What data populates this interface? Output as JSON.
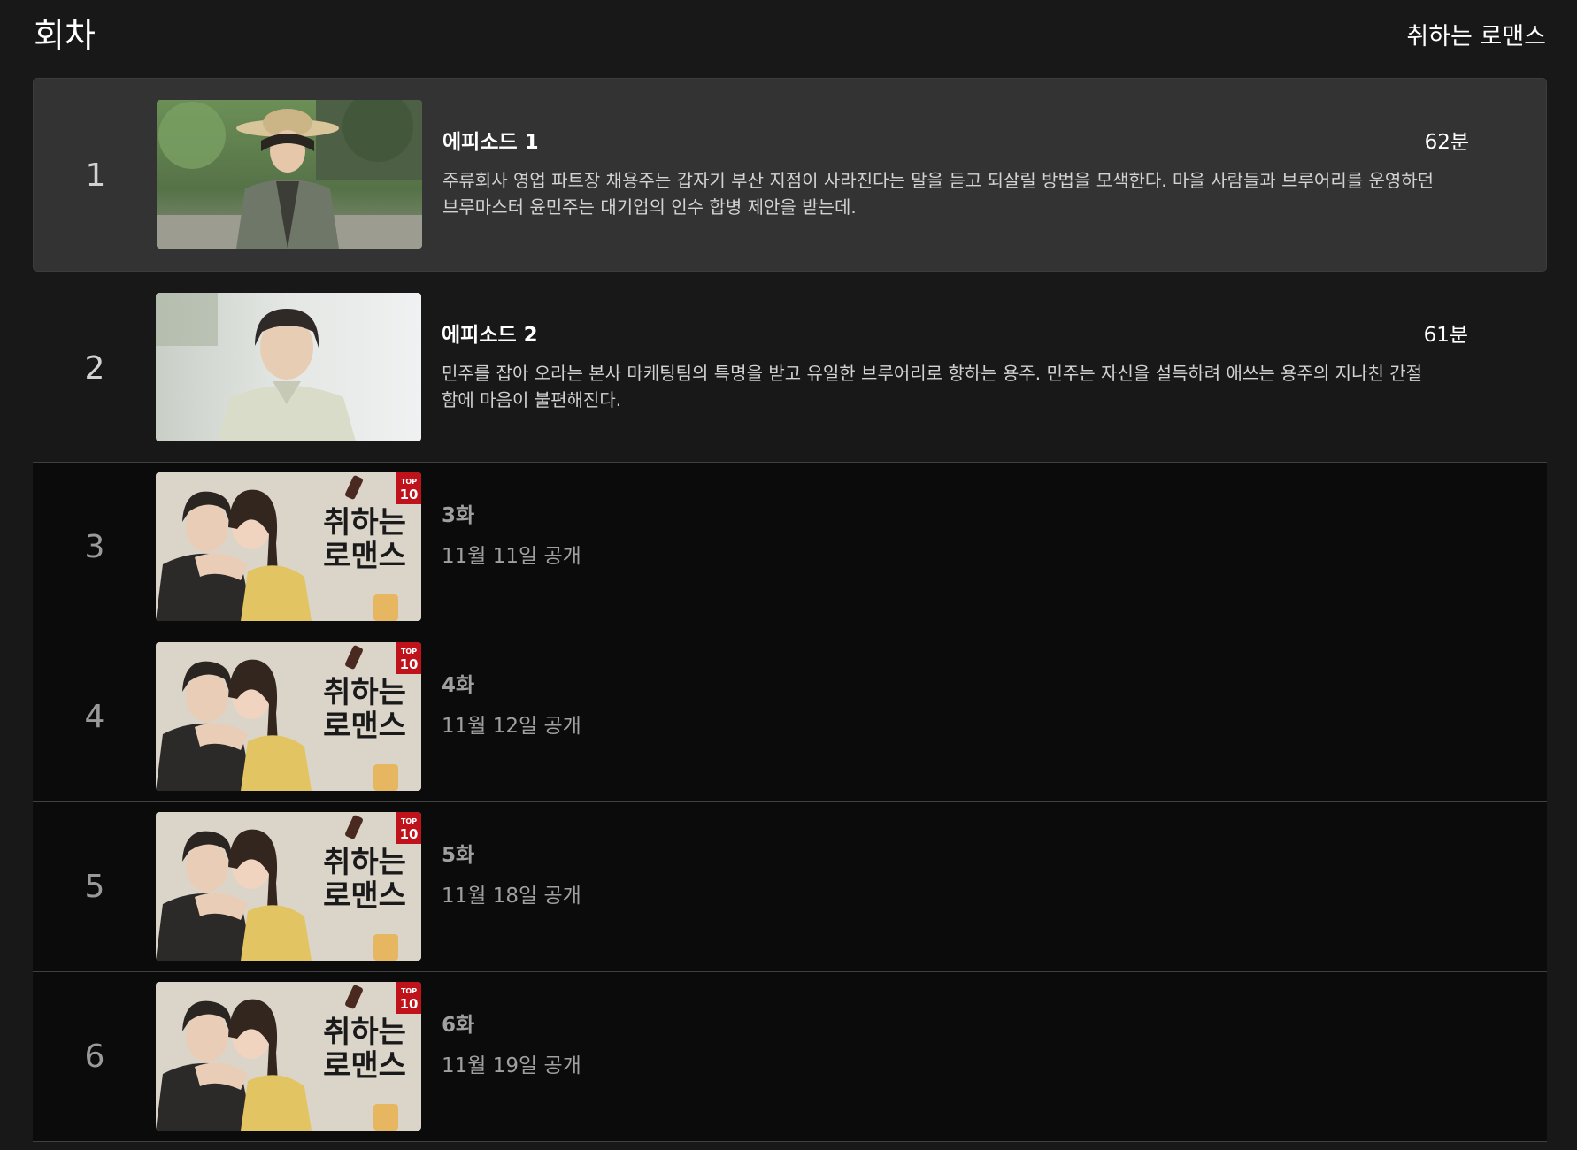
{
  "header": {
    "section_title": "회차",
    "show_title": "취하는 로맨스"
  },
  "episodes": [
    {
      "index": "1",
      "title": "에피소드 1",
      "duration": "62분",
      "synopsis": "주류회사 영업 파트장 채용주는 갑자기 부산 지점이 사라진다는 말을 듣고 되살릴 방법을 모색한다. 마을 사람들과 브루어리를 운영하던 브루마스터 윤민주는 대기업의 인수 합병 제안을 받는데.",
      "state": "current"
    },
    {
      "index": "2",
      "title": "에피소드 2",
      "duration": "61분",
      "synopsis": "민주를 잡아 오라는 본사 마케팅팀의 특명을 받고 유일한 브루어리로 향하는 용주. 민주는 자신을 설득하려 애쓰는 용주의 지나친 간절함에 마음이 불편해진다.",
      "state": "released"
    },
    {
      "index": "3",
      "label": "3화",
      "release": "11월 11일 공개",
      "state": "upcoming"
    },
    {
      "index": "4",
      "label": "4화",
      "release": "11월 12일 공개",
      "state": "upcoming"
    },
    {
      "index": "5",
      "label": "5화",
      "release": "11월 18일 공개",
      "state": "upcoming"
    },
    {
      "index": "6",
      "label": "6화",
      "release": "11월 19일 공개",
      "state": "upcoming"
    }
  ],
  "poster": {
    "title_art": "취하는 로맨스",
    "badge_top": "TOP",
    "badge_num": "10"
  },
  "colors": {
    "background": "#181818",
    "current_row": "#333333",
    "upcoming_row": "#0b0b0b",
    "badge_red": "#c0121b"
  }
}
